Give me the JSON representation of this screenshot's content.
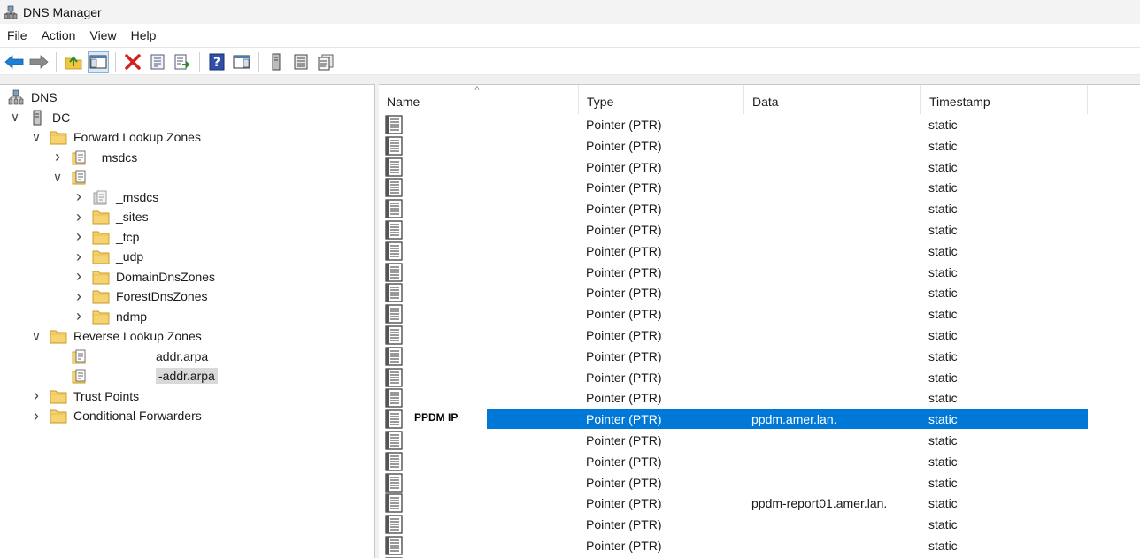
{
  "window": {
    "title": "DNS Manager"
  },
  "menu": [
    "File",
    "Action",
    "View",
    "Help"
  ],
  "toolbar": [
    {
      "icon": "back-arrow-icon"
    },
    {
      "icon": "forward-arrow-icon"
    },
    {
      "icon": "up-folder-icon"
    },
    {
      "icon": "show-hide-console-tree-icon",
      "pressed": true
    },
    {
      "icon": "delete-icon"
    },
    {
      "icon": "properties-icon"
    },
    {
      "icon": "export-list-icon"
    },
    {
      "icon": "help-icon"
    },
    {
      "icon": "show-action-pane-icon"
    },
    {
      "icon": "server-icon"
    },
    {
      "icon": "list-view-icon"
    },
    {
      "icon": "copy-records-icon"
    }
  ],
  "tree": [
    {
      "label": "DNS",
      "level": 0,
      "chevron": "none",
      "icon": "dns-icon"
    },
    {
      "label": "DC",
      "level": 1,
      "chevron": "down",
      "icon": "server-icon"
    },
    {
      "label": "Forward Lookup Zones",
      "level": 2,
      "chevron": "down",
      "icon": "folder-icon"
    },
    {
      "label": "_msdcs",
      "level": 3,
      "chevron": "right",
      "icon": "zone-icon"
    },
    {
      "label": "",
      "level": 3,
      "chevron": "down",
      "icon": "zone-icon"
    },
    {
      "label": "_msdcs",
      "level": 4,
      "chevron": "right",
      "icon": "delegated-zone-icon"
    },
    {
      "label": "_sites",
      "level": 4,
      "chevron": "right",
      "icon": "folder-icon"
    },
    {
      "label": "_tcp",
      "level": 4,
      "chevron": "right",
      "icon": "folder-icon"
    },
    {
      "label": "_udp",
      "level": 4,
      "chevron": "right",
      "icon": "folder-icon"
    },
    {
      "label": "DomainDnsZones",
      "level": 4,
      "chevron": "right",
      "icon": "folder-icon"
    },
    {
      "label": "ForestDnsZones",
      "level": 4,
      "chevron": "right",
      "icon": "folder-icon"
    },
    {
      "label": "ndmp",
      "level": 4,
      "chevron": "right",
      "icon": "folder-icon"
    },
    {
      "label": "Reverse Lookup Zones",
      "level": 2,
      "chevron": "down",
      "icon": "folder-icon"
    },
    {
      "label": "addr.arpa",
      "level": 3,
      "chevron": "none",
      "icon": "zone-icon",
      "redacted": true
    },
    {
      "label": "-addr.arpa",
      "level": 3,
      "chevron": "none",
      "icon": "zone-icon",
      "redacted": true,
      "selected": true
    },
    {
      "label": "Trust Points",
      "level": 2,
      "chevron": "right",
      "icon": "folder-icon"
    },
    {
      "label": "Conditional Forwarders",
      "level": 2,
      "chevron": "right",
      "icon": "folder-icon"
    }
  ],
  "list": {
    "columns": [
      "Name",
      "Type",
      "Data",
      "Timestamp"
    ],
    "rows": [
      {
        "name": "",
        "type": "Pointer (PTR)",
        "data": "",
        "timestamp": "static"
      },
      {
        "name": "",
        "type": "Pointer (PTR)",
        "data": "",
        "timestamp": "static"
      },
      {
        "name": "",
        "type": "Pointer (PTR)",
        "data": "",
        "timestamp": "static"
      },
      {
        "name": "",
        "type": "Pointer (PTR)",
        "data": "",
        "timestamp": "static"
      },
      {
        "name": "",
        "type": "Pointer (PTR)",
        "data": "",
        "timestamp": "static"
      },
      {
        "name": "",
        "type": "Pointer (PTR)",
        "data": "",
        "timestamp": "static"
      },
      {
        "name": "",
        "type": "Pointer (PTR)",
        "data": "",
        "timestamp": "static"
      },
      {
        "name": "",
        "type": "Pointer (PTR)",
        "data": "",
        "timestamp": "static"
      },
      {
        "name": "",
        "type": "Pointer (PTR)",
        "data": "",
        "timestamp": "static"
      },
      {
        "name": "",
        "type": "Pointer (PTR)",
        "data": "",
        "timestamp": "static"
      },
      {
        "name": "",
        "type": "Pointer (PTR)",
        "data": "",
        "timestamp": "static"
      },
      {
        "name": "",
        "type": "Pointer (PTR)",
        "data": "",
        "timestamp": "static"
      },
      {
        "name": "",
        "type": "Pointer (PTR)",
        "data": "",
        "timestamp": "static"
      },
      {
        "name": "",
        "type": "Pointer (PTR)",
        "data": "",
        "timestamp": "static"
      },
      {
        "name": "PPDM IP",
        "type": "Pointer (PTR)",
        "data": "ppdm.amer.lan.",
        "timestamp": "static",
        "selected": true
      },
      {
        "name": "",
        "type": "Pointer (PTR)",
        "data": "",
        "timestamp": "static"
      },
      {
        "name": "",
        "type": "Pointer (PTR)",
        "data": "",
        "timestamp": "static"
      },
      {
        "name": "",
        "type": "Pointer (PTR)",
        "data": "",
        "timestamp": "static"
      },
      {
        "name": "",
        "type": "Pointer (PTR)",
        "data": "ppdm-report01.amer.lan.",
        "timestamp": "static"
      },
      {
        "name": "",
        "type": "Pointer (PTR)",
        "data": "",
        "timestamp": "static"
      },
      {
        "name": "",
        "type": "Pointer (PTR)",
        "data": "",
        "timestamp": "static"
      },
      {
        "name": "",
        "type": "",
        "data": "",
        "timestamp": ""
      }
    ]
  },
  "colors": {
    "selection": "#0078d7",
    "tree_selection": "#d9d9d9",
    "folder": "#f4c542"
  }
}
